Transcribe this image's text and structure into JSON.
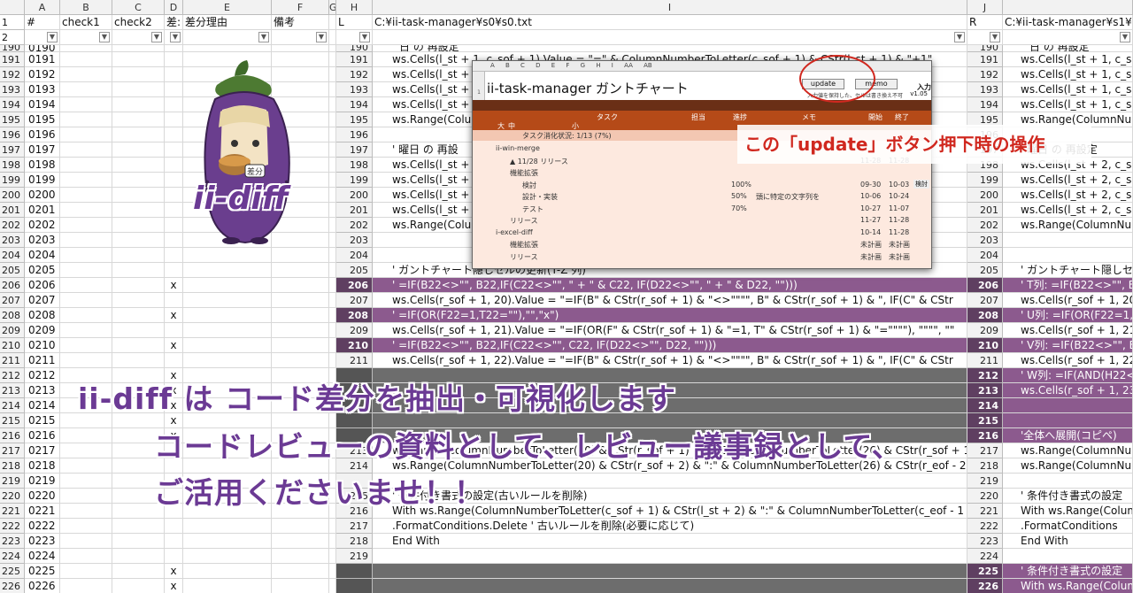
{
  "columns": {
    "left": [
      "A",
      "B",
      "C",
      "D",
      "E",
      "F",
      "G"
    ],
    "middle": [
      "H",
      "I"
    ],
    "right": [
      "J"
    ]
  },
  "header_row_labels": {
    "A": "#",
    "B": "check1",
    "C": "check2",
    "D": "差:",
    "E": "差分理由",
    "F": "備考"
  },
  "panel_headers": {
    "mid_letter": "L",
    "mid_path": "C:¥ii-task-manager¥s0¥s0.txt",
    "right_letter": "R",
    "right_path": "C:¥ii-task-manager¥s1¥s"
  },
  "rows": [
    {
      "n": "191",
      "id": "0191",
      "x": "",
      "ml": "191",
      "mt": "ws.Cells(l_st + 1, c_sof + 1).Value = \"=\" & ColumnNumberToLetter(c_sof + 1) & CStr(l_st + 1) & \"+1\"",
      "mk": "",
      "rl": "191",
      "rt": "ws.Cells(l_st + 1, c_sof",
      "rk": ""
    },
    {
      "n": "192",
      "id": "0192",
      "x": "",
      "ml": "192",
      "mt": "ws.Cells(l_st +",
      "mk": "",
      "rl": "192",
      "rt": "ws.Cells(l_st + 1, c_sof",
      "rk": ""
    },
    {
      "n": "193",
      "id": "0193",
      "x": "",
      "ml": "193",
      "mt": "ws.Cells(l_st +",
      "mk": "",
      "rl": "193",
      "rt": "ws.Cells(l_st + 1, c_sof",
      "rk": ""
    },
    {
      "n": "194",
      "id": "0194",
      "x": "",
      "ml": "194",
      "mt": "ws.Cells(l_st +",
      "mk": "",
      "rl": "194",
      "rt": "ws.Cells(l_st + 1, c_sof",
      "rk": ""
    },
    {
      "n": "195",
      "id": "0195",
      "x": "",
      "ml": "195",
      "mt": "ws.Range(Colu",
      "mk": "",
      "rl": "195",
      "rt": "ws.Range(ColumnNum",
      "rk": ""
    },
    {
      "n": "196",
      "id": "0196",
      "x": "",
      "ml": "196",
      "mt": "",
      "mk": "",
      "rl": "196",
      "rt": "",
      "rk": ""
    },
    {
      "n": "197",
      "id": "0197",
      "x": "",
      "ml": "197",
      "mt": "' 曜日 の 再設",
      "mk": "",
      "rl": "197",
      "rt": "' 曜日 の 再設定",
      "rk": ""
    },
    {
      "n": "198",
      "id": "0198",
      "x": "",
      "ml": "198",
      "mt": "ws.Cells(l_st +",
      "mk": "",
      "rl": "198",
      "rt": "ws.Cells(l_st + 2, c_sof",
      "rk": ""
    },
    {
      "n": "199",
      "id": "0199",
      "x": "",
      "ml": "199",
      "mt": "ws.Cells(l_st +",
      "mk": "",
      "rl": "199",
      "rt": "ws.Cells(l_st + 2, c_sof",
      "rk": ""
    },
    {
      "n": "200",
      "id": "0200",
      "x": "",
      "ml": "200",
      "mt": "ws.Cells(l_st +",
      "mk": "",
      "rl": "200",
      "rt": "ws.Cells(l_st + 2, c_sof",
      "rk": ""
    },
    {
      "n": "201",
      "id": "0201",
      "x": "",
      "ml": "201",
      "mt": "ws.Cells(l_st +",
      "mk": "",
      "rl": "201",
      "rt": "ws.Cells(l_st + 2, c_sof",
      "rk": ""
    },
    {
      "n": "202",
      "id": "0202",
      "x": "",
      "ml": "202",
      "mt": "ws.Range(Colu",
      "mk": "",
      "rl": "202",
      "rt": "ws.Range(ColumnNum",
      "rk": ""
    },
    {
      "n": "203",
      "id": "0203",
      "x": "",
      "ml": "203",
      "mt": "",
      "mk": "",
      "rl": "203",
      "rt": "",
      "rk": ""
    },
    {
      "n": "204",
      "id": "0204",
      "x": "",
      "ml": "204",
      "mt": "",
      "mk": "",
      "rl": "204",
      "rt": "",
      "rk": ""
    },
    {
      "n": "205",
      "id": "0205",
      "x": "",
      "ml": "205",
      "mt": "' ガントチャート隠しセルの更新(T-Z 列)",
      "mk": "",
      "rl": "205",
      "rt": "' ガントチャート隠しセ",
      "rk": ""
    },
    {
      "n": "206",
      "id": "0206",
      "x": "x",
      "ml": "206",
      "mt": "' =IF(B22<>\"\", B22,IF(C22<>\"\", \" + \" & C22, IF(D22<>\"\", \" + \" & D22, \"\")))",
      "mk": "p",
      "rl": "206",
      "rt": "' T列: =IF(B22<>\"\", B",
      "rk": "p"
    },
    {
      "n": "207",
      "id": "0207",
      "x": "",
      "ml": "207",
      "mt": "ws.Cells(r_sof + 1, 20).Value = \"=IF(B\" & CStr(r_sof + 1) & \"<>\"\"\"\", B\" & CStr(r_sof + 1) & \", IF(C\" & CStr",
      "mk": "",
      "rl": "207",
      "rt": "ws.Cells(r_sof + 1, 20",
      "rk": ""
    },
    {
      "n": "208",
      "id": "0208",
      "x": "x",
      "ml": "208",
      "mt": "' =IF(OR(F22=1,T22=\"\"),\"\",\"x\")",
      "mk": "p",
      "rl": "208",
      "rt": "' U列: =IF(OR(F22=1,",
      "rk": "p"
    },
    {
      "n": "209",
      "id": "0209",
      "x": "",
      "ml": "209",
      "mt": "ws.Cells(r_sof + 1, 21).Value = \"=IF(OR(F\" & CStr(r_sof + 1) & \"=1, T\" & CStr(r_sof + 1) & \"=\"\"\"\"), \"\"\"\", \"\"",
      "mk": "",
      "rl": "209",
      "rt": "ws.Cells(r_sof + 1, 21",
      "rk": ""
    },
    {
      "n": "210",
      "id": "0210",
      "x": "x",
      "ml": "210",
      "mt": "' =IF(B22<>\"\", B22,IF(C22<>\"\", C22, IF(D22<>\"\", D22, \"\")))",
      "mk": "p",
      "rl": "210",
      "rt": "' V列: =IF(B22<>\"\", B",
      "rk": "p"
    },
    {
      "n": "211",
      "id": "0211",
      "x": "",
      "ml": "211",
      "mt": "ws.Cells(r_sof + 1, 22).Value = \"=IF(B\" & CStr(r_sof + 1) & \"<>\"\"\"\", B\" & CStr(r_sof + 1) & \", IF(C\" & CStr",
      "mk": "",
      "rl": "211",
      "rt": "ws.Cells(r_sof + 1, 22",
      "rk": ""
    },
    {
      "n": "212",
      "id": "0212",
      "x": "x",
      "ml": "",
      "mt": "",
      "mk": "g",
      "rl": "212",
      "rt": "' W列: =IF(AND(H22<",
      "rk": "p"
    },
    {
      "n": "213",
      "id": "0213",
      "x": "x",
      "ml": "",
      "mt": "",
      "mk": "g",
      "rl": "213",
      "rt": "ws.Cells(r_sof + 1, 23",
      "rk": "p"
    },
    {
      "n": "214",
      "id": "0214",
      "x": "x",
      "ml": "",
      "mt": "",
      "mk": "g",
      "rl": "214",
      "rt": "",
      "rk": "p"
    },
    {
      "n": "215",
      "id": "0215",
      "x": "x",
      "ml": "",
      "mt": "",
      "mk": "g",
      "rl": "215",
      "rt": "",
      "rk": "p"
    },
    {
      "n": "216",
      "id": "0216",
      "x": "x",
      "ml": "",
      "mt": "",
      "mk": "g",
      "rl": "216",
      "rt": "'全体へ展開(コピペ)",
      "rk": "p"
    },
    {
      "n": "217",
      "id": "0217",
      "x": "",
      "ml": "213",
      "mt": "ws.Range(ColumnNumberToLetter(20) & CStr(r_sof + 1) & \":\" & ColumnNumberToLetter(26) & CStr(r_sof + 1",
      "mk": "",
      "rl": "217",
      "rt": "ws.Range(ColumnNum",
      "rk": ""
    },
    {
      "n": "218",
      "id": "0218",
      "x": "",
      "ml": "214",
      "mt": "ws.Range(ColumnNumberToLetter(20) & CStr(r_sof + 2) & \":\" & ColumnNumberToLetter(26) & CStr(r_eof - 2",
      "mk": "",
      "rl": "218",
      "rt": "ws.Range(ColumnNum",
      "rk": ""
    },
    {
      "n": "219",
      "id": "0219",
      "x": "",
      "ml": "",
      "mt": "",
      "mk": "",
      "rl": "219",
      "rt": "",
      "rk": ""
    },
    {
      "n": "220",
      "id": "0220",
      "x": "",
      "ml": "215",
      "mt": "' 条件付き書式の設定(古いルールを削除)",
      "mk": "",
      "rl": "220",
      "rt": "' 条件付き書式の設定",
      "rk": ""
    },
    {
      "n": "221",
      "id": "0221",
      "x": "",
      "ml": "216",
      "mt": "With ws.Range(ColumnNumberToLetter(c_sof + 1) & CStr(l_st + 2) & \":\" & ColumnNumberToLetter(c_eof - 1",
      "mk": "",
      "rl": "221",
      "rt": "With ws.Range(Colum",
      "rk": ""
    },
    {
      "n": "222",
      "id": "0222",
      "x": "",
      "ml": "217",
      "mt": "    .FormatConditions.Delete ' 古いルールを削除(必要に応じて)",
      "mk": "",
      "rl": "222",
      "rt": "    .FormatConditions",
      "rk": ""
    },
    {
      "n": "223",
      "id": "0223",
      "x": "",
      "ml": "218",
      "mt": "End With",
      "mk": "",
      "rl": "223",
      "rt": "End With",
      "rk": ""
    },
    {
      "n": "224",
      "id": "0224",
      "x": "",
      "ml": "219",
      "mt": "",
      "mk": "",
      "rl": "224",
      "rt": "",
      "rk": ""
    },
    {
      "n": "225",
      "id": "0225",
      "x": "x",
      "ml": "",
      "mt": "",
      "mk": "g",
      "rl": "225",
      "rt": "' 条件付き書式の設定",
      "rk": "p"
    },
    {
      "n": "226",
      "id": "0226",
      "x": "x",
      "ml": "",
      "mt": "",
      "mk": "g",
      "rl": "226",
      "rt": "With ws.Range(Colum",
      "rk": "p"
    }
  ],
  "top_partial_row": {
    "n": "190",
    "id": "0190",
    "ml": "190",
    "mt": "日 の 再設定",
    "rl": "190",
    "rt": "日 の 再設定"
  },
  "gantt": {
    "title": "ii-task-manager ガントチャート",
    "col_letters": "A B C D E F G H I AA AB",
    "update_label": "update",
    "memo_label": "memo",
    "note": "入力値を保持した、セルは書き換え不可",
    "version": "v1.05",
    "side_label": "入力",
    "headers": {
      "task": "タスク",
      "owner": "担当",
      "progress": "進捗",
      "memo": "メモ",
      "start": "開始",
      "end": "終了",
      "big": "大",
      "mid": "中",
      "small": "小"
    },
    "status": "タスク消化状況: 1/13 (7%)",
    "row_numbers": [
      "1",
      "18",
      "19",
      "20",
      "21",
      "22",
      "23",
      "24",
      "25",
      "26",
      "27",
      "28",
      "29",
      "30",
      "31",
      "32"
    ],
    "lines": [
      {
        "t": "ii-win-merge",
        "p": "",
        "m": "",
        "s": "",
        "e": ""
      },
      {
        "t": "▲ 11/28 リリース",
        "p": "",
        "m": "",
        "s": "11-28",
        "e": "11-28"
      },
      {
        "t": "機能拡張",
        "p": "",
        "m": "",
        "s": "",
        "e": ""
      },
      {
        "t": "検討",
        "p": "100%",
        "m": "",
        "s": "09-30",
        "e": "10-03"
      },
      {
        "t": "設計・実装",
        "p": "50%",
        "m": "頭に特定の文字列を",
        "s": "10-06",
        "e": "10-24"
      },
      {
        "t": "テスト",
        "p": "70%",
        "m": "",
        "s": "10-27",
        "e": "11-07"
      },
      {
        "t": "リリース",
        "p": "",
        "m": "",
        "s": "11-27",
        "e": "11-28"
      },
      {
        "t": "i-excel-diff",
        "p": "",
        "m": "",
        "s": "10-14",
        "e": "11-28"
      },
      {
        "t": "機能拡張",
        "p": "",
        "m": "",
        "s": "未計画",
        "e": "未計画"
      },
      {
        "t": "リリース",
        "p": "",
        "m": "",
        "s": "未計画",
        "e": "未計画"
      }
    ],
    "side_tag": "検討"
  },
  "annotation": "この「update」ボタン押下時の操作",
  "logo_text": "ii-diff",
  "logo_badge": "差分",
  "captions": [
    "ii-diff は コード差分を抽出・可視化します",
    "コードレビューの資料として、レビュー議事録として、",
    "ご活用くださいませ！！"
  ],
  "colors": {
    "purple": "#8c5a8e",
    "grey": "#6d6d6d",
    "caption": "#6b3a94",
    "annot": "#d0281f",
    "gantt_head": "#b54a18"
  }
}
